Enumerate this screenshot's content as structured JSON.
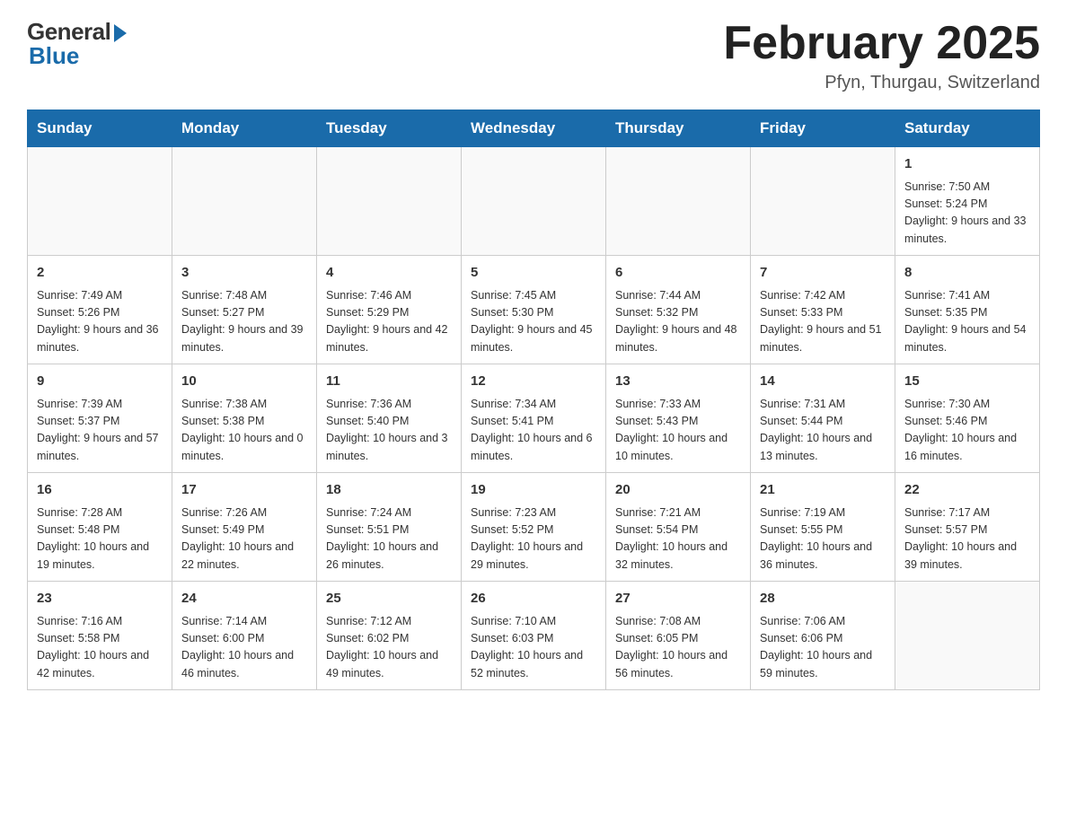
{
  "logo": {
    "general": "General",
    "blue": "Blue"
  },
  "title": "February 2025",
  "location": "Pfyn, Thurgau, Switzerland",
  "days_of_week": [
    "Sunday",
    "Monday",
    "Tuesday",
    "Wednesday",
    "Thursday",
    "Friday",
    "Saturday"
  ],
  "weeks": [
    [
      {
        "day": "",
        "info": ""
      },
      {
        "day": "",
        "info": ""
      },
      {
        "day": "",
        "info": ""
      },
      {
        "day": "",
        "info": ""
      },
      {
        "day": "",
        "info": ""
      },
      {
        "day": "",
        "info": ""
      },
      {
        "day": "1",
        "info": "Sunrise: 7:50 AM\nSunset: 5:24 PM\nDaylight: 9 hours and 33 minutes."
      }
    ],
    [
      {
        "day": "2",
        "info": "Sunrise: 7:49 AM\nSunset: 5:26 PM\nDaylight: 9 hours and 36 minutes."
      },
      {
        "day": "3",
        "info": "Sunrise: 7:48 AM\nSunset: 5:27 PM\nDaylight: 9 hours and 39 minutes."
      },
      {
        "day": "4",
        "info": "Sunrise: 7:46 AM\nSunset: 5:29 PM\nDaylight: 9 hours and 42 minutes."
      },
      {
        "day": "5",
        "info": "Sunrise: 7:45 AM\nSunset: 5:30 PM\nDaylight: 9 hours and 45 minutes."
      },
      {
        "day": "6",
        "info": "Sunrise: 7:44 AM\nSunset: 5:32 PM\nDaylight: 9 hours and 48 minutes."
      },
      {
        "day": "7",
        "info": "Sunrise: 7:42 AM\nSunset: 5:33 PM\nDaylight: 9 hours and 51 minutes."
      },
      {
        "day": "8",
        "info": "Sunrise: 7:41 AM\nSunset: 5:35 PM\nDaylight: 9 hours and 54 minutes."
      }
    ],
    [
      {
        "day": "9",
        "info": "Sunrise: 7:39 AM\nSunset: 5:37 PM\nDaylight: 9 hours and 57 minutes."
      },
      {
        "day": "10",
        "info": "Sunrise: 7:38 AM\nSunset: 5:38 PM\nDaylight: 10 hours and 0 minutes."
      },
      {
        "day": "11",
        "info": "Sunrise: 7:36 AM\nSunset: 5:40 PM\nDaylight: 10 hours and 3 minutes."
      },
      {
        "day": "12",
        "info": "Sunrise: 7:34 AM\nSunset: 5:41 PM\nDaylight: 10 hours and 6 minutes."
      },
      {
        "day": "13",
        "info": "Sunrise: 7:33 AM\nSunset: 5:43 PM\nDaylight: 10 hours and 10 minutes."
      },
      {
        "day": "14",
        "info": "Sunrise: 7:31 AM\nSunset: 5:44 PM\nDaylight: 10 hours and 13 minutes."
      },
      {
        "day": "15",
        "info": "Sunrise: 7:30 AM\nSunset: 5:46 PM\nDaylight: 10 hours and 16 minutes."
      }
    ],
    [
      {
        "day": "16",
        "info": "Sunrise: 7:28 AM\nSunset: 5:48 PM\nDaylight: 10 hours and 19 minutes."
      },
      {
        "day": "17",
        "info": "Sunrise: 7:26 AM\nSunset: 5:49 PM\nDaylight: 10 hours and 22 minutes."
      },
      {
        "day": "18",
        "info": "Sunrise: 7:24 AM\nSunset: 5:51 PM\nDaylight: 10 hours and 26 minutes."
      },
      {
        "day": "19",
        "info": "Sunrise: 7:23 AM\nSunset: 5:52 PM\nDaylight: 10 hours and 29 minutes."
      },
      {
        "day": "20",
        "info": "Sunrise: 7:21 AM\nSunset: 5:54 PM\nDaylight: 10 hours and 32 minutes."
      },
      {
        "day": "21",
        "info": "Sunrise: 7:19 AM\nSunset: 5:55 PM\nDaylight: 10 hours and 36 minutes."
      },
      {
        "day": "22",
        "info": "Sunrise: 7:17 AM\nSunset: 5:57 PM\nDaylight: 10 hours and 39 minutes."
      }
    ],
    [
      {
        "day": "23",
        "info": "Sunrise: 7:16 AM\nSunset: 5:58 PM\nDaylight: 10 hours and 42 minutes."
      },
      {
        "day": "24",
        "info": "Sunrise: 7:14 AM\nSunset: 6:00 PM\nDaylight: 10 hours and 46 minutes."
      },
      {
        "day": "25",
        "info": "Sunrise: 7:12 AM\nSunset: 6:02 PM\nDaylight: 10 hours and 49 minutes."
      },
      {
        "day": "26",
        "info": "Sunrise: 7:10 AM\nSunset: 6:03 PM\nDaylight: 10 hours and 52 minutes."
      },
      {
        "day": "27",
        "info": "Sunrise: 7:08 AM\nSunset: 6:05 PM\nDaylight: 10 hours and 56 minutes."
      },
      {
        "day": "28",
        "info": "Sunrise: 7:06 AM\nSunset: 6:06 PM\nDaylight: 10 hours and 59 minutes."
      },
      {
        "day": "",
        "info": ""
      }
    ]
  ]
}
